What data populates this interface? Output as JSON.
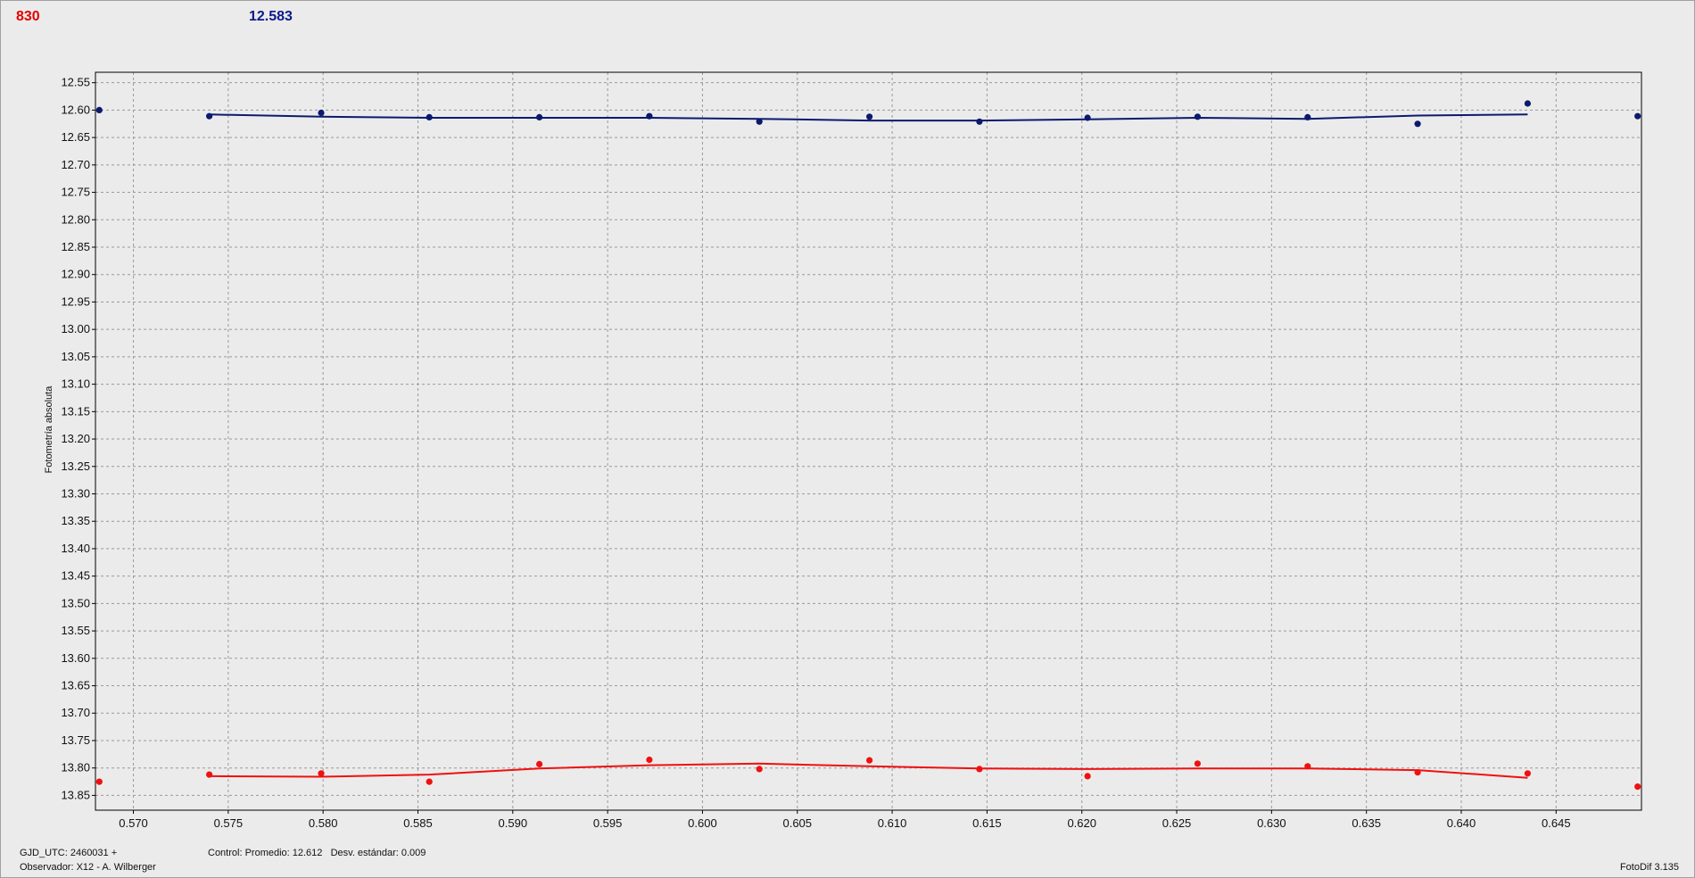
{
  "header": {
    "left_value": "830",
    "right_value": "12.583"
  },
  "footer": {
    "gjd": "GJD_UTC: 2460031 +",
    "observer": "Observador: X12 - A. Wilberger",
    "control": "Control: Promedio: 12.612   Desv. estándar: 0.009",
    "version": "FotoDif 3.135"
  },
  "colors": {
    "blue_series": "#0b1a6e",
    "red_series": "#f01010",
    "grid": "#9a9a9a",
    "background": "#ebebeb"
  },
  "chart_data": {
    "type": "scatter",
    "ylabel": "Fotometría absoluta",
    "xlabel": "",
    "xlim": [
      0.568,
      0.6495
    ],
    "ylim": [
      12.531,
      13.877
    ],
    "y_inverted": true,
    "grid": true,
    "xticks": [
      0.57,
      0.575,
      0.58,
      0.585,
      0.59,
      0.595,
      0.6,
      0.605,
      0.61,
      0.615,
      0.62,
      0.625,
      0.63,
      0.635,
      0.64,
      0.645
    ],
    "yticks": [
      12.55,
      12.6,
      12.65,
      12.7,
      12.75,
      12.8,
      12.85,
      12.9,
      12.95,
      13.0,
      13.05,
      13.1,
      13.15,
      13.2,
      13.25,
      13.3,
      13.35,
      13.4,
      13.45,
      13.5,
      13.55,
      13.6,
      13.65,
      13.7,
      13.75,
      13.8,
      13.85
    ],
    "series": [
      {
        "color": "#0b1a6e",
        "points": [
          [
            0.5682,
            12.6
          ],
          [
            0.574,
            12.611
          ],
          [
            0.5799,
            12.605
          ],
          [
            0.5856,
            12.613
          ],
          [
            0.5914,
            12.613
          ],
          [
            0.5972,
            12.611
          ],
          [
            0.603,
            12.621
          ],
          [
            0.6088,
            12.612
          ],
          [
            0.6146,
            12.621
          ],
          [
            0.6203,
            12.614
          ],
          [
            0.6261,
            12.612
          ],
          [
            0.6319,
            12.613
          ],
          [
            0.6377,
            12.625
          ],
          [
            0.6435,
            12.588
          ],
          [
            0.6493,
            12.611
          ]
        ],
        "fit": [
          [
            0.574,
            12.608
          ],
          [
            0.5799,
            12.612
          ],
          [
            0.5856,
            12.614
          ],
          [
            0.5914,
            12.614
          ],
          [
            0.5972,
            12.614
          ],
          [
            0.603,
            12.616
          ],
          [
            0.6088,
            12.619
          ],
          [
            0.6146,
            12.619
          ],
          [
            0.6203,
            12.617
          ],
          [
            0.6261,
            12.614
          ],
          [
            0.6319,
            12.616
          ],
          [
            0.6377,
            12.61
          ],
          [
            0.6435,
            12.608
          ]
        ]
      },
      {
        "color": "#f01010",
        "points": [
          [
            0.5682,
            13.825
          ],
          [
            0.574,
            13.812
          ],
          [
            0.5799,
            13.81
          ],
          [
            0.5856,
            13.825
          ],
          [
            0.5914,
            13.793
          ],
          [
            0.5972,
            13.785
          ],
          [
            0.603,
            13.802
          ],
          [
            0.6088,
            13.786
          ],
          [
            0.6146,
            13.802
          ],
          [
            0.6203,
            13.815
          ],
          [
            0.6261,
            13.792
          ],
          [
            0.6319,
            13.797
          ],
          [
            0.6377,
            13.808
          ],
          [
            0.6435,
            13.81
          ],
          [
            0.6493,
            13.834
          ]
        ],
        "fit": [
          [
            0.574,
            13.815
          ],
          [
            0.5799,
            13.816
          ],
          [
            0.5856,
            13.812
          ],
          [
            0.5914,
            13.801
          ],
          [
            0.5972,
            13.795
          ],
          [
            0.603,
            13.792
          ],
          [
            0.6088,
            13.797
          ],
          [
            0.6146,
            13.801
          ],
          [
            0.6203,
            13.802
          ],
          [
            0.6261,
            13.801
          ],
          [
            0.6319,
            13.801
          ],
          [
            0.6377,
            13.804
          ],
          [
            0.6435,
            13.818
          ]
        ]
      }
    ]
  }
}
